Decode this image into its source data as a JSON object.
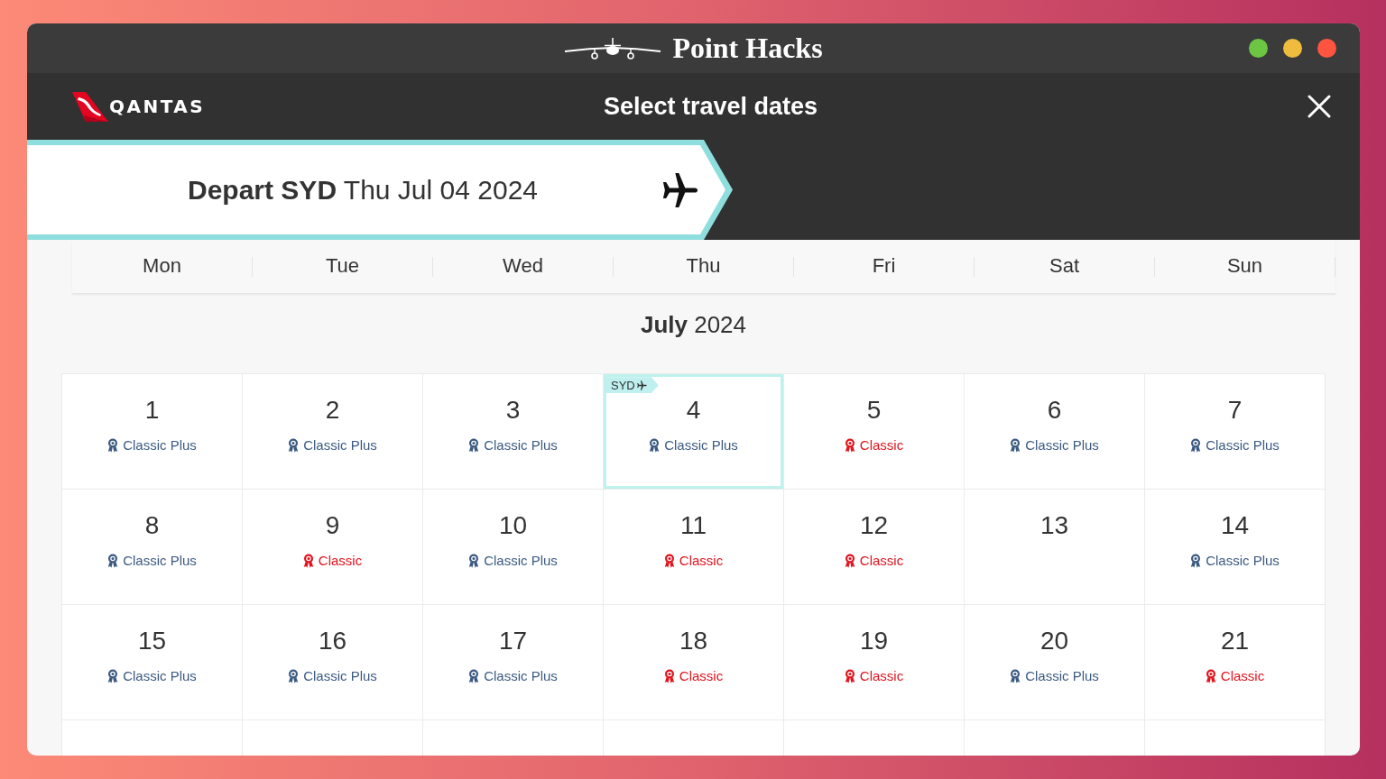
{
  "window": {
    "title": "Point Hacks"
  },
  "airline": {
    "wordmark": "QANTAS"
  },
  "dialog": {
    "title": "Select travel dates"
  },
  "journey": {
    "label": "**Depart SYD** Thu Jul 04 2024"
  },
  "weekdays": [
    "Mon",
    "Tue",
    "Wed",
    "Thu",
    "Fri",
    "Sat",
    "Sun"
  ],
  "month": {
    "title": "**July** 2024"
  },
  "days": [
    {
      "date": "1",
      "selected": false,
      "award": {
        "kind": "classic_plus",
        "label": "Classic Plus"
      }
    },
    {
      "date": "2",
      "selected": false,
      "award": {
        "kind": "classic_plus",
        "label": "Classic Plus"
      }
    },
    {
      "date": "3",
      "selected": false,
      "award": {
        "kind": "classic_plus",
        "label": "Classic Plus"
      }
    },
    {
      "date": "4",
      "selected": true,
      "tag": "SYD",
      "award": {
        "kind": "classic_plus",
        "label": "Classic Plus"
      }
    },
    {
      "date": "5",
      "selected": false,
      "award": {
        "kind": "classic",
        "label": "Classic"
      }
    },
    {
      "date": "6",
      "selected": false,
      "award": {
        "kind": "classic_plus",
        "label": "Classic Plus"
      }
    },
    {
      "date": "7",
      "selected": false,
      "award": {
        "kind": "classic_plus",
        "label": "Classic Plus"
      }
    },
    {
      "date": "8",
      "selected": false,
      "award": {
        "kind": "classic_plus",
        "label": "Classic Plus"
      }
    },
    {
      "date": "9",
      "selected": false,
      "award": {
        "kind": "classic",
        "label": "Classic"
      }
    },
    {
      "date": "10",
      "selected": false,
      "award": {
        "kind": "classic_plus",
        "label": "Classic Plus"
      }
    },
    {
      "date": "11",
      "selected": false,
      "award": {
        "kind": "classic",
        "label": "Classic"
      }
    },
    {
      "date": "12",
      "selected": false,
      "award": {
        "kind": "classic",
        "label": "Classic"
      }
    },
    {
      "date": "13",
      "selected": false
    },
    {
      "date": "14",
      "selected": false,
      "award": {
        "kind": "classic_plus",
        "label": "Classic Plus"
      }
    },
    {
      "date": "15",
      "selected": false,
      "award": {
        "kind": "classic_plus",
        "label": "Classic Plus"
      }
    },
    {
      "date": "16",
      "selected": false,
      "award": {
        "kind": "classic_plus",
        "label": "Classic Plus"
      }
    },
    {
      "date": "17",
      "selected": false,
      "award": {
        "kind": "classic_plus",
        "label": "Classic Plus"
      }
    },
    {
      "date": "18",
      "selected": false,
      "award": {
        "kind": "classic",
        "label": "Classic"
      }
    },
    {
      "date": "19",
      "selected": false,
      "award": {
        "kind": "classic",
        "label": "Classic"
      }
    },
    {
      "date": "20",
      "selected": false,
      "award": {
        "kind": "classic_plus",
        "label": "Classic Plus"
      }
    },
    {
      "date": "21",
      "selected": false,
      "award": {
        "kind": "classic",
        "label": "Classic"
      }
    },
    {
      "selected": false
    },
    {
      "selected": false
    },
    {
      "selected": false
    },
    {
      "selected": false
    },
    {
      "selected": false
    },
    {
      "selected": false
    },
    {
      "selected": false
    }
  ]
}
